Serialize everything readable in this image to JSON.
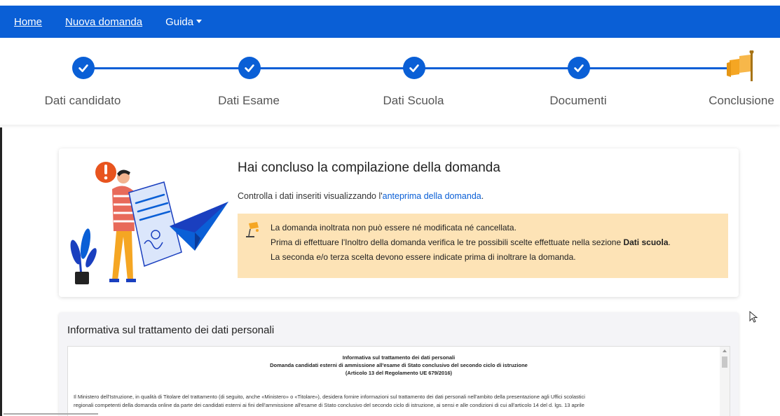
{
  "nav": {
    "home": "Home",
    "nuova_domanda": "Nuova domanda",
    "guida": "Guida"
  },
  "steps": [
    {
      "label": "Dati candidato",
      "done": true
    },
    {
      "label": "Dati Esame",
      "done": true
    },
    {
      "label": "Dati Scuola",
      "done": true
    },
    {
      "label": "Documenti",
      "done": true
    },
    {
      "label": "Conclusione",
      "done": false
    }
  ],
  "conclusion": {
    "title": "Hai concluso la compilazione della domanda",
    "intro_text": "Controlla i dati inseriti visualizzando l'",
    "intro_link": "anteprima della domanda",
    "intro_end": ".",
    "notice_line1": "La domanda inoltrata non può essere né modificata né cancellata.",
    "notice_line2_start": "Prima di effettuare l'Inoltro della domanda verifica le tre possibili scelte effettuate nella sezione ",
    "notice_line2_bold": "Dati scuola",
    "notice_line2_end": ".",
    "notice_line3": "La seconda e/o terza scelta devono essere indicate prima di inoltrare la domanda."
  },
  "informativa": {
    "title": "Informativa sul trattamento dei dati personali",
    "doc_heading1": "Informativa sul trattamento dei dati personali",
    "doc_heading2": "Domanda candidati esterni di ammissione all'esame di Stato conclusivo del secondo ciclo di istruzione",
    "doc_heading3": "(Articolo 13 del Regolamento UE 679/2016)",
    "doc_body_1": "Il Ministero dell'Istruzione, in qualità di Titolare del trattamento (di seguito, anche «Ministero» o «Titolare»), desidera fornire informazioni sul trattamento dei dati personali nell'ambito della presentazione agli Uffici scolastici",
    "doc_body_2": "regionali competenti della domanda online da parte dei candidati esterni ai fini dell'ammissione all'esame di Stato conclusivo del secondo ciclo di istruzione, ai sensi e alle condizioni di cui all'articolo 14 del d. lgs. 13 aprile"
  },
  "colors": {
    "primary": "#0a5fd6",
    "notice_bg": "#fde3b6",
    "flag": "#f5a623"
  }
}
